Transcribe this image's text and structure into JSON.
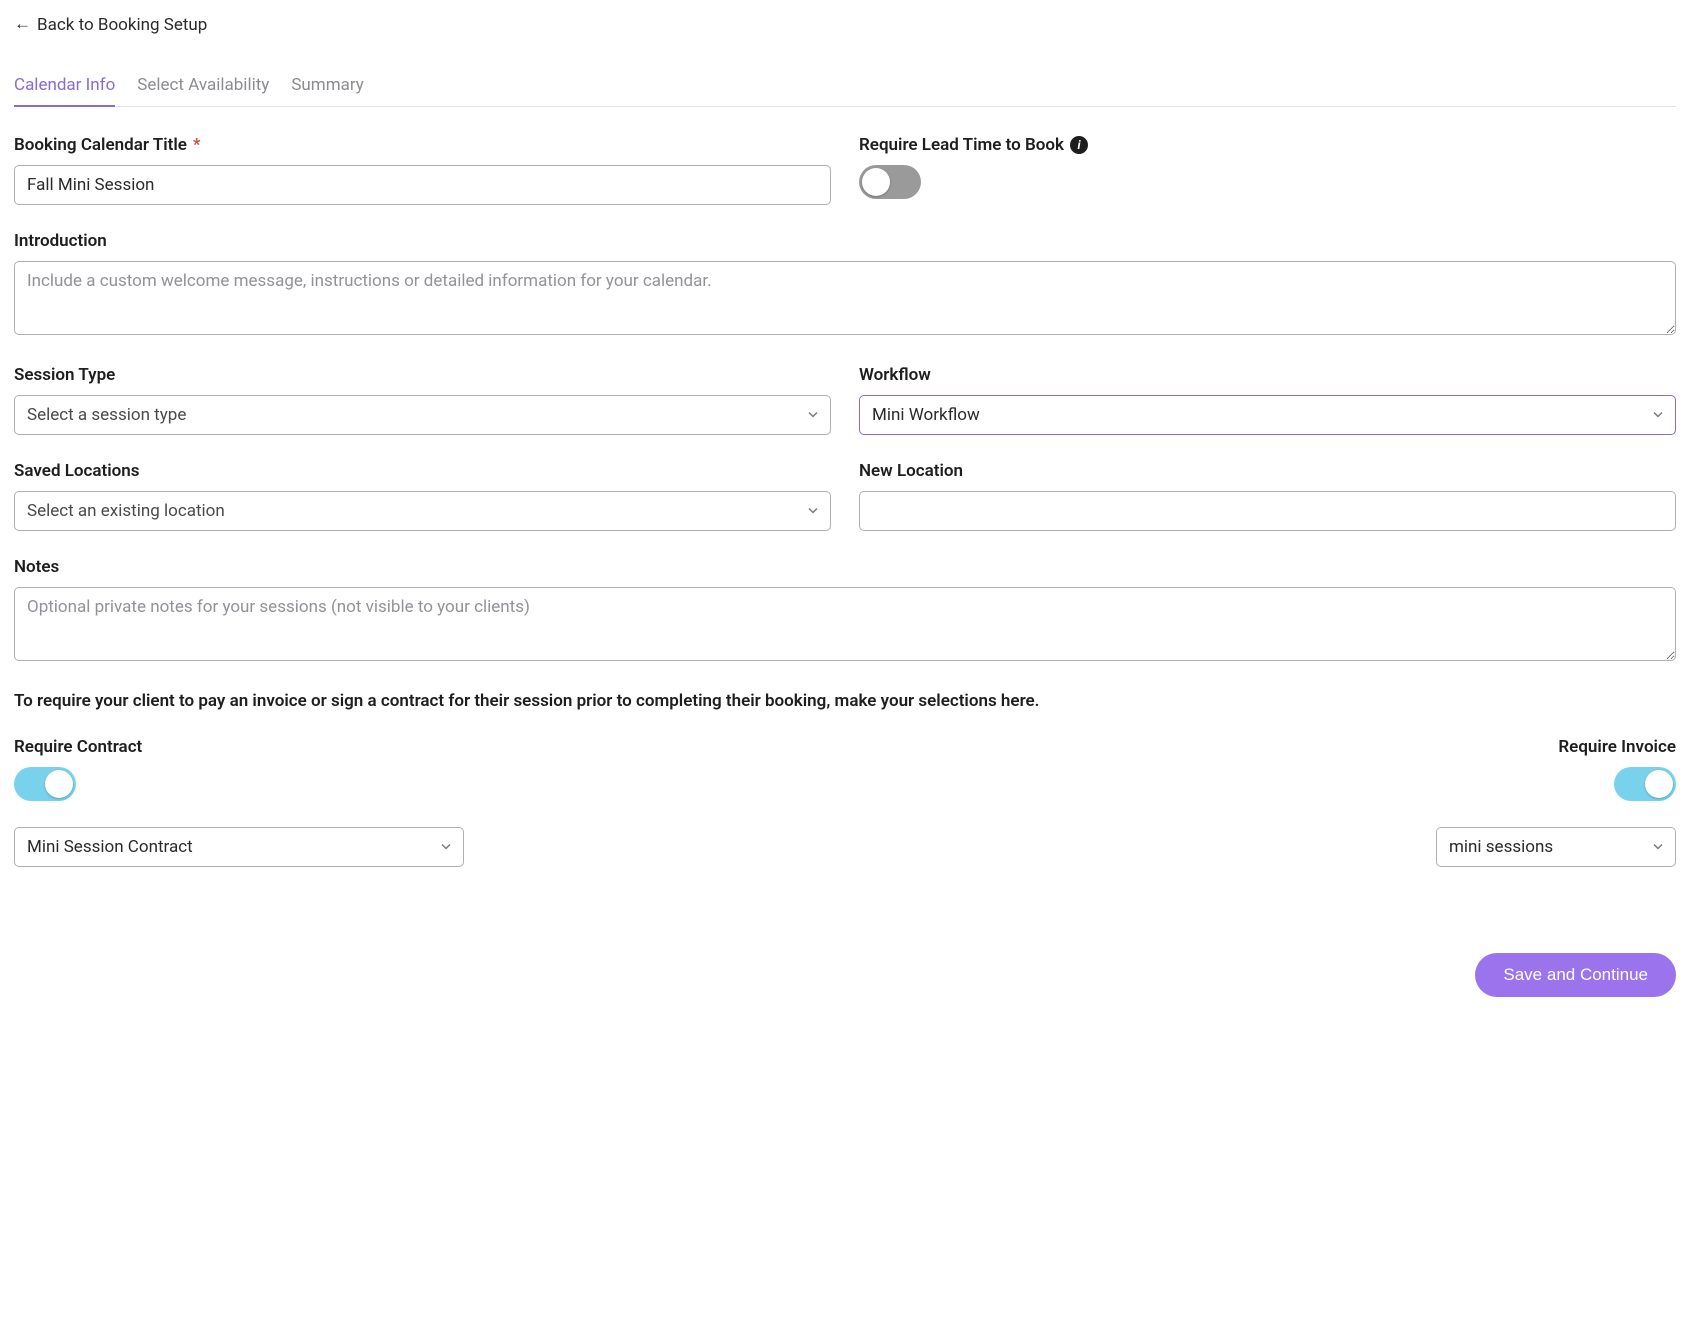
{
  "back_link": "Back to Booking Setup",
  "tabs": [
    "Calendar Info",
    "Select Availability",
    "Summary"
  ],
  "active_tab_index": 0,
  "fields": {
    "title": {
      "label": "Booking Calendar Title",
      "required_marker": "*",
      "value": "Fall Mini Session"
    },
    "lead_time": {
      "label": "Require Lead Time to Book",
      "value": false
    },
    "introduction": {
      "label": "Introduction",
      "placeholder": "Include a custom welcome message, instructions or detailed information for your calendar.",
      "value": ""
    },
    "session_type": {
      "label": "Session Type",
      "placeholder": "Select a session type",
      "value": ""
    },
    "workflow": {
      "label": "Workflow",
      "value": "Mini Workflow"
    },
    "saved_locations": {
      "label": "Saved Locations",
      "placeholder": "Select an existing location",
      "value": ""
    },
    "new_location": {
      "label": "New Location",
      "value": ""
    },
    "notes": {
      "label": "Notes",
      "placeholder": "Optional private notes for your sessions (not visible to your clients)",
      "value": ""
    }
  },
  "helper_text": "To require your client to pay an invoice or sign a contract for their session prior to completing their booking, make your selections here.",
  "require_contract": {
    "label": "Require Contract",
    "toggle": true,
    "select_value": "Mini Session Contract"
  },
  "require_invoice": {
    "label": "Require Invoice",
    "toggle": true,
    "select_value": "mini sessions"
  },
  "footer_button": "Save and Continue"
}
